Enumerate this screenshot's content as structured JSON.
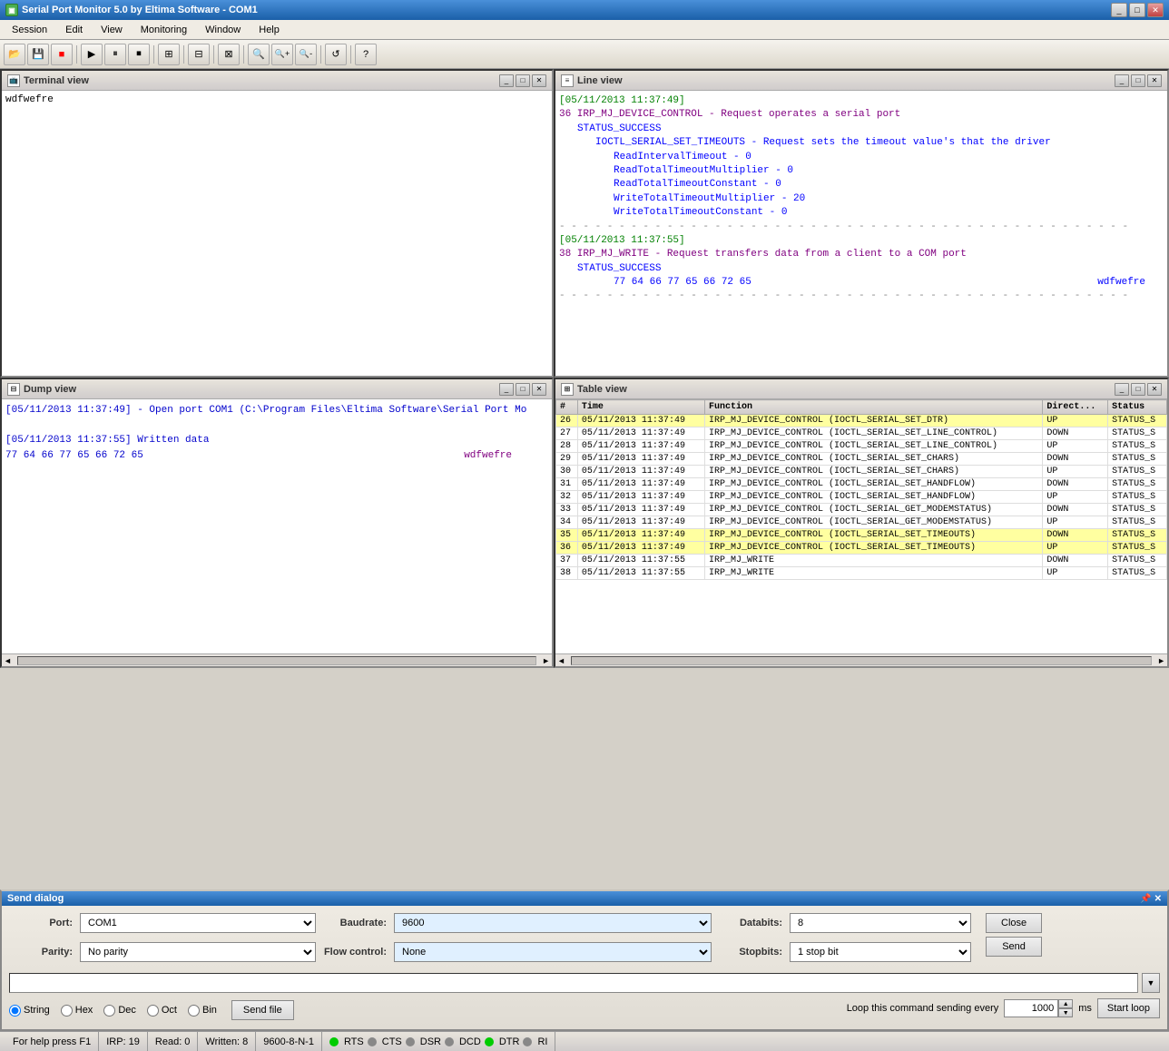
{
  "titlebar": {
    "title": "Serial Port Monitor 5.0 by Eltima Software - COM1",
    "icon": "▣"
  },
  "menubar": {
    "items": [
      "Session",
      "Edit",
      "View",
      "Monitoring",
      "Window",
      "Help"
    ]
  },
  "toolbar": {
    "buttons": [
      "📁",
      "💾",
      "🔴",
      "|",
      "▶",
      "⏸",
      "⏹",
      "|",
      "⊞",
      "|",
      "⊟",
      "|",
      "⊠",
      "|",
      "🔍",
      "🔍+",
      "🔍-",
      "|",
      "🔄",
      "|",
      "❓"
    ]
  },
  "terminal_view": {
    "title": "Terminal view",
    "content": "wdfwefre"
  },
  "line_view": {
    "title": "Line view",
    "entries": [
      {
        "timestamp": "[05/11/2013 11:37:49]",
        "indent": 0,
        "color": "timestamp"
      },
      {
        "text": "36 IRP_MJ_DEVICE_CONTROL - Request operates a serial port",
        "indent": 0,
        "color": "purple"
      },
      {
        "text": "STATUS_SUCCESS",
        "indent": 1,
        "color": "blue"
      },
      {
        "text": "IOCTL_SERIAL_SET_TIMEOUTS - Request sets the timeout value's that the driver",
        "indent": 2,
        "color": "blue"
      },
      {
        "text": "ReadIntervalTimeout          - 0",
        "indent": 3,
        "color": "blue"
      },
      {
        "text": "ReadTotalTimeoutMultiplier   - 0",
        "indent": 3,
        "color": "blue"
      },
      {
        "text": "ReadTotalTimeoutConstant     - 0",
        "indent": 3,
        "color": "blue"
      },
      {
        "text": "WriteTotalTimeoutMultiplier  - 20",
        "indent": 3,
        "color": "blue"
      },
      {
        "text": "WriteTotalTimeoutConstant    - 0",
        "indent": 3,
        "color": "blue"
      },
      {
        "text": "---",
        "indent": 0,
        "color": "divider"
      },
      {
        "timestamp": "[05/11/2013 11:37:55]",
        "indent": 0,
        "color": "timestamp"
      },
      {
        "text": "38 IRP_MJ_WRITE - Request transfers data from a client to a COM port",
        "indent": 0,
        "color": "purple"
      },
      {
        "text": "STATUS_SUCCESS",
        "indent": 1,
        "color": "blue"
      },
      {
        "text": "77 64 66 77 65 66 72 65",
        "indent": 3,
        "color": "blue",
        "rightText": "wdfwefre"
      }
    ]
  },
  "dump_view": {
    "title": "Dump view",
    "line1": "[05/11/2013 11:37:49] - Open port COM1 (C:\\Program Files\\Eltima Software\\Serial Port Mo",
    "line2": "[05/11/2013 11:37:55] Written data",
    "hex": "    77 64 66 77 65 66 72 65",
    "ascii": "wdfwefre"
  },
  "table_view": {
    "title": "Table view",
    "columns": [
      "#",
      "Time",
      "Function",
      "Direct...",
      "Status"
    ],
    "rows": [
      {
        "num": "26",
        "time": "05/11/2013 11:37:49",
        "func": "IRP_MJ_DEVICE_CONTROL (IOCTL_SERIAL_SET_DTR)",
        "dir": "UP",
        "status": "STATUS_S",
        "highlight": true
      },
      {
        "num": "27",
        "time": "05/11/2013 11:37:49",
        "func": "IRP_MJ_DEVICE_CONTROL (IOCTL_SERIAL_SET_LINE_CONTROL)",
        "dir": "DOWN",
        "status": "STATUS_S",
        "highlight": false
      },
      {
        "num": "28",
        "time": "05/11/2013 11:37:49",
        "func": "IRP_MJ_DEVICE_CONTROL (IOCTL_SERIAL_SET_LINE_CONTROL)",
        "dir": "UP",
        "status": "STATUS_S",
        "highlight": false
      },
      {
        "num": "29",
        "time": "05/11/2013 11:37:49",
        "func": "IRP_MJ_DEVICE_CONTROL (IOCTL_SERIAL_SET_CHARS)",
        "dir": "DOWN",
        "status": "STATUS_S",
        "highlight": false
      },
      {
        "num": "30",
        "time": "05/11/2013 11:37:49",
        "func": "IRP_MJ_DEVICE_CONTROL (IOCTL_SERIAL_SET_CHARS)",
        "dir": "UP",
        "status": "STATUS_S",
        "highlight": false
      },
      {
        "num": "31",
        "time": "05/11/2013 11:37:49",
        "func": "IRP_MJ_DEVICE_CONTROL (IOCTL_SERIAL_SET_HANDFLOW)",
        "dir": "DOWN",
        "status": "STATUS_S",
        "highlight": false
      },
      {
        "num": "32",
        "time": "05/11/2013 11:37:49",
        "func": "IRP_MJ_DEVICE_CONTROL (IOCTL_SERIAL_SET_HANDFLOW)",
        "dir": "UP",
        "status": "STATUS_S",
        "highlight": false
      },
      {
        "num": "33",
        "time": "05/11/2013 11:37:49",
        "func": "IRP_MJ_DEVICE_CONTROL (IOCTL_SERIAL_GET_MODEMSTATUS)",
        "dir": "DOWN",
        "status": "STATUS_S",
        "highlight": false
      },
      {
        "num": "34",
        "time": "05/11/2013 11:37:49",
        "func": "IRP_MJ_DEVICE_CONTROL (IOCTL_SERIAL_GET_MODEMSTATUS)",
        "dir": "UP",
        "status": "STATUS_S",
        "highlight": false
      },
      {
        "num": "35",
        "time": "05/11/2013 11:37:49",
        "func": "IRP_MJ_DEVICE_CONTROL (IOCTL_SERIAL_SET_TIMEOUTS)",
        "dir": "DOWN",
        "status": "STATUS_S",
        "highlight": true
      },
      {
        "num": "36",
        "time": "05/11/2013 11:37:49",
        "func": "IRP_MJ_DEVICE_CONTROL (IOCTL_SERIAL_SET_TIMEOUTS)",
        "dir": "UP",
        "status": "STATUS_S",
        "highlight": true
      },
      {
        "num": "37",
        "time": "05/11/2013 11:37:55",
        "func": "IRP_MJ_WRITE",
        "dir": "DOWN",
        "status": "STATUS_S",
        "highlight": false
      },
      {
        "num": "38",
        "time": "05/11/2013 11:37:55",
        "func": "IRP_MJ_WRITE",
        "dir": "UP",
        "status": "STATUS_S",
        "highlight": false
      }
    ]
  },
  "send_dialog": {
    "title": "Send dialog",
    "port_label": "Port:",
    "port_value": "COM1",
    "baudrate_label": "Baudrate:",
    "baudrate_value": "9600",
    "databits_label": "Databits:",
    "databits_value": "8",
    "parity_label": "Parity:",
    "parity_value": "No parity",
    "flowcontrol_label": "Flow control:",
    "flowcontrol_value": "None",
    "stopbits_label": "Stopbits:",
    "stopbits_value": "1 stop bit",
    "send_text": "",
    "radio_options": [
      "String",
      "Hex",
      "Dec",
      "Oct",
      "Bin"
    ],
    "radio_selected": "String",
    "send_file_label": "Send file",
    "loop_label": "Loop this command sending every",
    "loop_value": "1000",
    "loop_unit": "ms",
    "start_loop_label": "Start loop",
    "close_label": "Close",
    "send_label": "Send"
  },
  "statusbar": {
    "help": "For help press F1",
    "irp": "IRP: 19",
    "read": "Read: 0",
    "written": "Written: 8",
    "config": "9600-8-N-1",
    "leds": [
      {
        "name": "RTS",
        "on": true
      },
      {
        "name": "CTS",
        "on": false
      },
      {
        "name": "DSR",
        "on": false
      },
      {
        "name": "DCD",
        "on": false
      },
      {
        "name": "DTR",
        "on": true
      },
      {
        "name": "RI",
        "on": false
      }
    ]
  }
}
